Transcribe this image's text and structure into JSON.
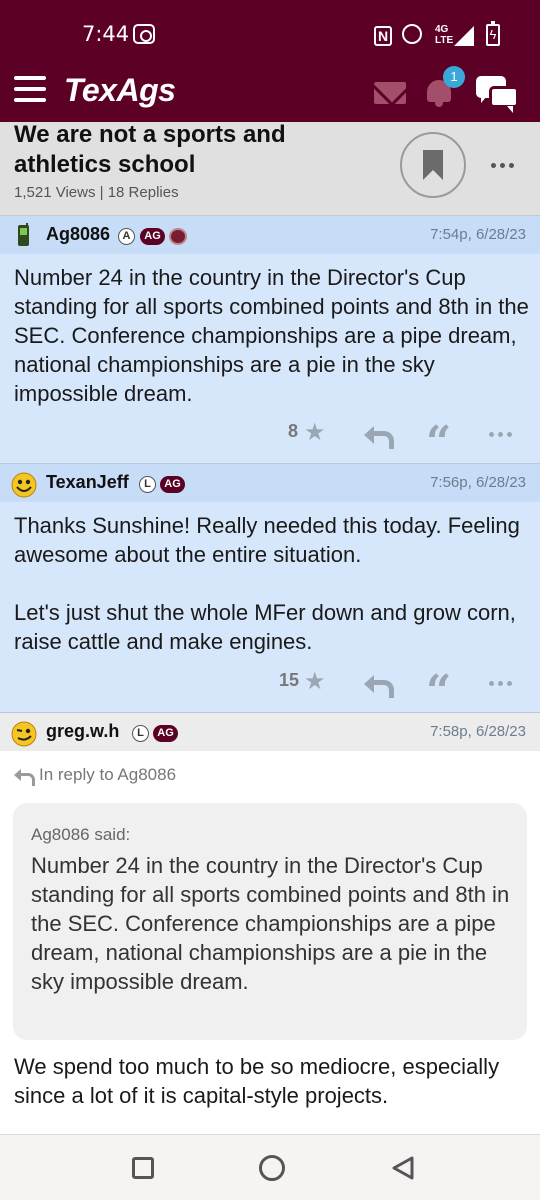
{
  "status_bar": {
    "time": "7:44",
    "network": "4G LTE"
  },
  "header": {
    "logo": "TexAgs",
    "notification_count": "1"
  },
  "thread": {
    "title": "We are not a sports and athletics school",
    "views": "1,521 Views",
    "separator": "|",
    "replies": "18 Replies"
  },
  "posts": [
    {
      "username": "Ag8086",
      "badges": [
        "A",
        "AG"
      ],
      "timestamp": "7:54p, 6/28/23",
      "body": "Number 24 in the country in the Director's Cup standing for all sports combined points and 8th in the SEC. Conference championships are a pipe dream, national championships are a pie in the sky impossible dream.",
      "likes": "8"
    },
    {
      "username": "TexanJeff",
      "badges": [
        "L",
        "AG"
      ],
      "timestamp": "7:56p, 6/28/23",
      "body": "Thanks Sunshine! Really needed this today. Feeling awesome about the entire situation.\n\nLet's just shut the whole MFer down and grow corn, raise cattle and make engines.",
      "likes": "15"
    },
    {
      "username": "greg.w.h",
      "badges": [
        "L",
        "AG"
      ],
      "timestamp": "7:58p, 6/28/23",
      "in_reply_to": "In reply to Ag8086",
      "quote_author": "Ag8086 said:",
      "quote_text": "Number 24 in the country in the Director's Cup standing for all sports combined points and 8th in the SEC. Conference championships are a pipe dream, national championships are a pie in the sky impossible dream.",
      "body": "We spend too much to be so mediocre, especially since a lot of it is capital-style projects."
    }
  ],
  "colors": {
    "brand_maroon": "#5c0025",
    "post_blue": "#d7e7fb",
    "post_header_blue": "#c6dcf7",
    "notification_badge": "#3aa9d9"
  }
}
